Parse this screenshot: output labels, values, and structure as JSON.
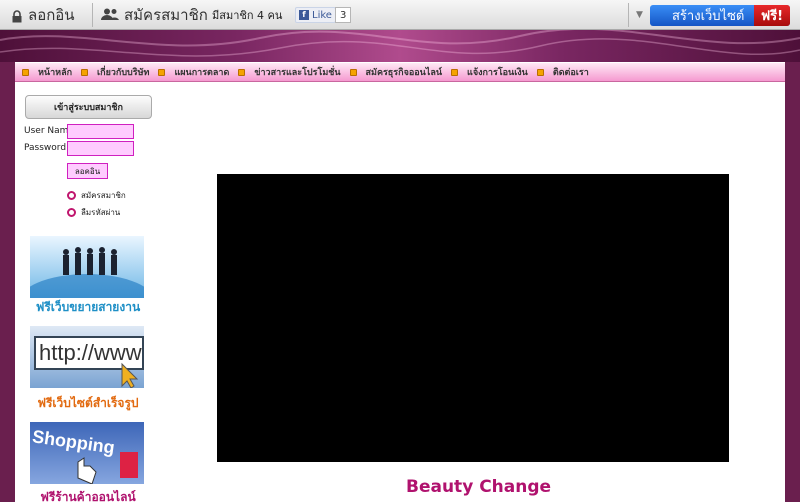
{
  "toolbar": {
    "login_label": "ลอกอิน",
    "register_label": "สมัครสมาชิก",
    "member_count": "มีสมาชิก 4 คน",
    "like_label": "Like",
    "like_count": "3",
    "create_site_label": "สร้างเว็บไซต์",
    "free_label": "ฟรี!"
  },
  "nav": {
    "items": [
      {
        "label": "หน้าหลัก"
      },
      {
        "label": "เกี่ยวกับบริษัท"
      },
      {
        "label": "แผนการตลาด"
      },
      {
        "label": "ข่าวสารและโปรโมชั่น"
      },
      {
        "label": "สมัครธุรกิจออนไลน์"
      },
      {
        "label": "แจ้งการโอนเงิน"
      },
      {
        "label": "ติดต่อเรา"
      }
    ]
  },
  "sidebar": {
    "login_header": "เข้าสู่ระบบสมาชิก",
    "username_label": "User Name",
    "password_label": "Password",
    "login_button": "ลอคอิน",
    "register_link": "สมัครสมาชิก",
    "forgot_link": "ลืมรหัสผ่าน",
    "banners": [
      {
        "caption": "ฟรีเว็บขยายสายงาน",
        "color": "#1e8fc6",
        "image_text": ""
      },
      {
        "caption": "ฟรีเว็บไซต์สำเร็จรูป",
        "color": "#e26a10",
        "image_text": "http://www"
      },
      {
        "caption": "ฟรีร้านค้าออนไลน์",
        "color": "#b0126e",
        "image_text": "Shopping"
      }
    ]
  },
  "main": {
    "video_title": "Beauty Change"
  }
}
